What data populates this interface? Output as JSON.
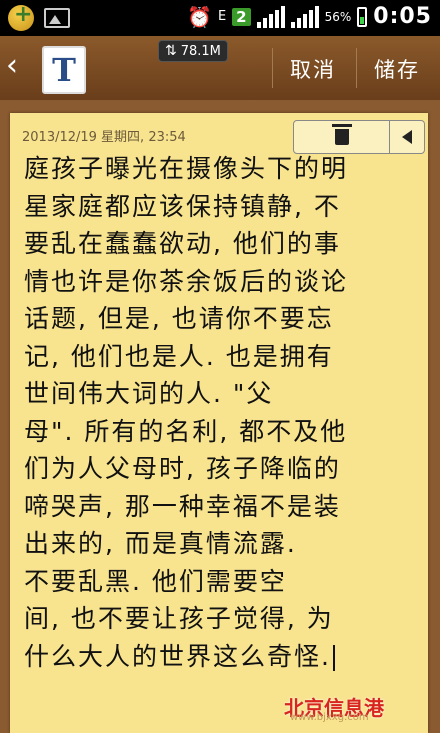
{
  "status_bar": {
    "network_type": "E",
    "notification_count": "2",
    "battery_percent": "56%",
    "time": "0:05",
    "icons": [
      "app-icon",
      "gallery-icon",
      "alarm-icon",
      "signal-icon",
      "battery-icon"
    ]
  },
  "toolbar": {
    "memory": "78.1M",
    "cancel_label": "取消",
    "save_label": "储存",
    "app_letter": "T"
  },
  "note": {
    "date": "2013/12/19 星期四, 23:54",
    "lines": [
      "庭孩子曝光在摄像头下的明",
      "星家庭都应该保持镇静, 不",
      "要乱在蠢蠢欲动, 他们的事",
      "情也许是你茶余饭后的谈论",
      "话题, 但是, 也请你不要忘",
      "记, 他们也是人. 也是拥有",
      "世间伟大词的人. \"父",
      "母\". 所有的名利, 都不及他",
      "们为人父母时, 孩子降临的",
      "啼哭声, 那一种幸福不是装",
      "出来的, 而是真情流露.",
      "不要乱黑. 他们需要空",
      "间, 也不要让孩子觉得, 为",
      "什么大人的世界这么奇怪."
    ]
  },
  "watermark": {
    "text": "北京信息港",
    "url": "www.bjxxg.com"
  },
  "colors": {
    "note_bg": "#f8e48f",
    "toolbar": "#7a4a22",
    "accent_badge": "#3a9a2a"
  }
}
